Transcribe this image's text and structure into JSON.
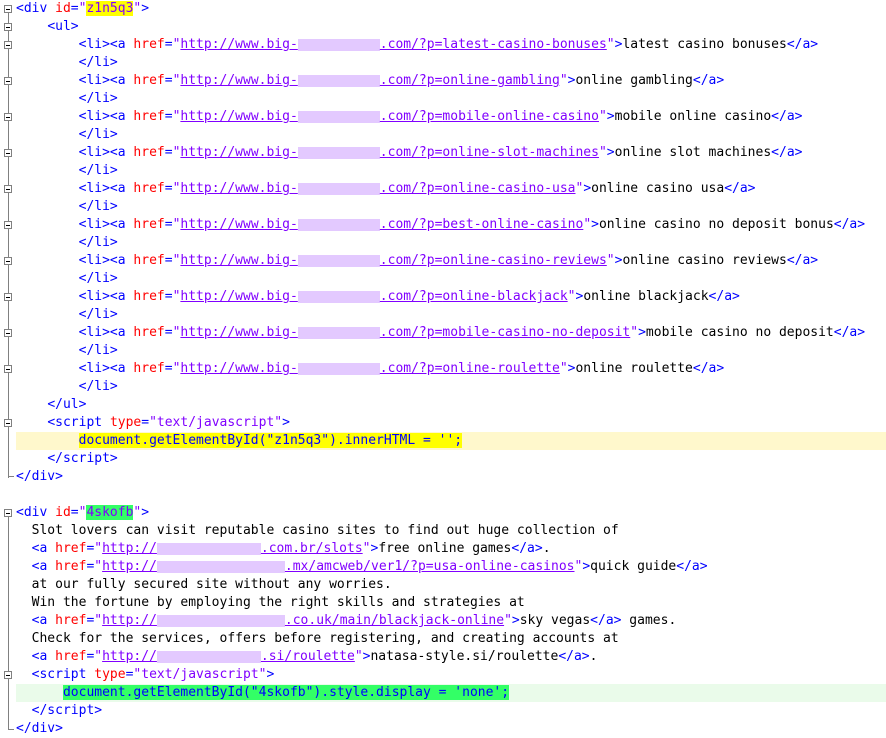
{
  "block1": {
    "div_id": "z1n5q3",
    "url_prefix": "http://www.big-",
    "url_mid": ".com/?p=",
    "links": [
      {
        "slug": "latest-casino-bonuses",
        "text": "latest casino bonuses"
      },
      {
        "slug": "online-gambling",
        "text": "online gambling"
      },
      {
        "slug": "mobile-online-casino",
        "text": "mobile online casino"
      },
      {
        "slug": "online-slot-machines",
        "text": "online slot machines"
      },
      {
        "slug": "online-casino-usa",
        "text": "online casino usa"
      },
      {
        "slug": "best-online-casino",
        "text": "online casino no deposit bonus"
      },
      {
        "slug": "online-casino-reviews",
        "text": "online casino reviews"
      },
      {
        "slug": "online-blackjack",
        "text": "online blackjack"
      },
      {
        "slug": "mobile-casino-no-deposit",
        "text": "mobile casino no deposit"
      },
      {
        "slug": "online-roulette",
        "text": "online roulette"
      }
    ],
    "script_code": "document.getElementById(\"z1n5q3\").innerHTML = '';"
  },
  "block2": {
    "div_id": "4skofb",
    "text1": "Slot lovers can visit reputable casino sites to find out huge collection of",
    "link1": {
      "pre": "http://",
      "post": ".com.br/slots",
      "text": "free online games"
    },
    "link2": {
      "pre": "http://",
      "post": ".mx/amcweb/ver1/?p=usa-online-casinos",
      "text": "quick guide"
    },
    "text2": "at our fully secured site without any worries.",
    "text3": "Win the fortune by employing the right skills and strategies at",
    "link3": {
      "pre": "http://",
      "post": ".co.uk/main/blackjack-online",
      "text": "sky vegas",
      "after": " games."
    },
    "text4": "Check for the services, offers before registering, and creating accounts at",
    "link4": {
      "pre": "http://",
      "post": ".si/roulette",
      "text": "natasa-style.si/roulette"
    },
    "script_code": "document.getElementById(\"4skofb\").style.display = 'none';"
  },
  "colors": {
    "tag": "#0000ff",
    "attr": "#ff0000",
    "value": "#8000ff",
    "highlight_yellow": "#ffff00",
    "highlight_green": "#33ff66",
    "redaction": "#e3c9ff"
  }
}
